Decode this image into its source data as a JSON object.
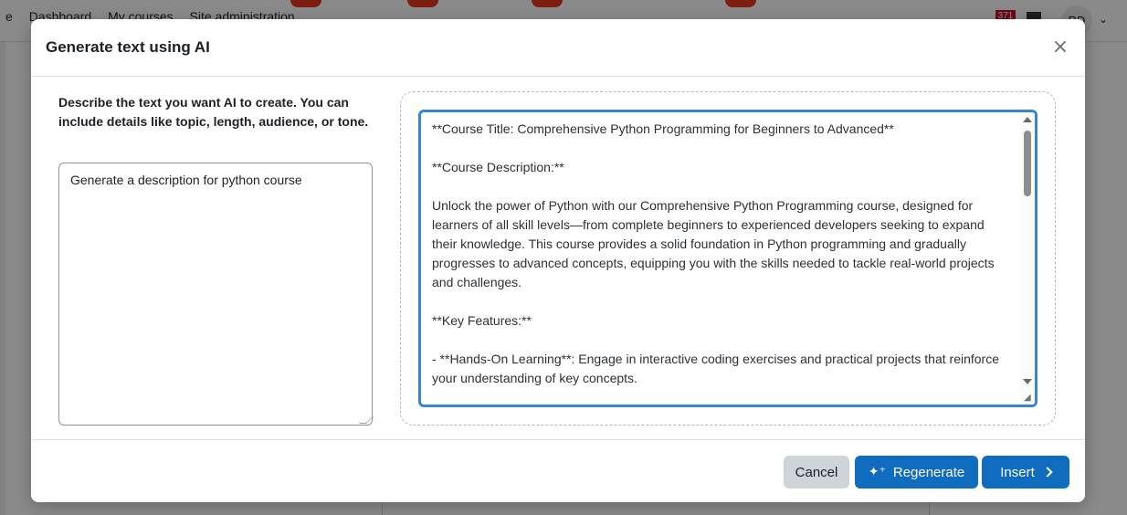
{
  "background": {
    "nav": [
      "e",
      "Dashboard",
      "My courses",
      "Site administration"
    ],
    "notification_count": "371",
    "avatar_initials": "RD",
    "brand_color": "#e8341c"
  },
  "modal": {
    "title": "Generate text using AI",
    "close_label": "×",
    "prompt_label": "Describe the text you want AI to create. You can include details like topic, length, audience, or tone.",
    "prompt_value": "Generate a description for python course",
    "response_text": "**Course Title: Comprehensive Python Programming for Beginners to Advanced**\n\n**Course Description:**\n\nUnlock the power of Python with our Comprehensive Python Programming course, designed for learners of all skill levels—from complete beginners to experienced developers seeking to expand their knowledge. This course provides a solid foundation in Python programming and gradually progresses to advanced concepts, equipping you with the skills needed to tackle real-world projects and challenges.\n\n**Key Features:**\n\n- **Hands-On Learning**: Engage in interactive coding exercises and practical projects that reinforce your understanding of key concepts.",
    "buttons": {
      "cancel": "Cancel",
      "regenerate": "Regenerate",
      "insert": "Insert"
    }
  },
  "colors": {
    "primary": "#0f6cbf",
    "focus_border": "#3584d6",
    "secondary_button": "#ced4da"
  },
  "icons": {
    "close": "close-icon",
    "regenerate": "sparkle-icon",
    "insert": "chevron-right-icon"
  }
}
